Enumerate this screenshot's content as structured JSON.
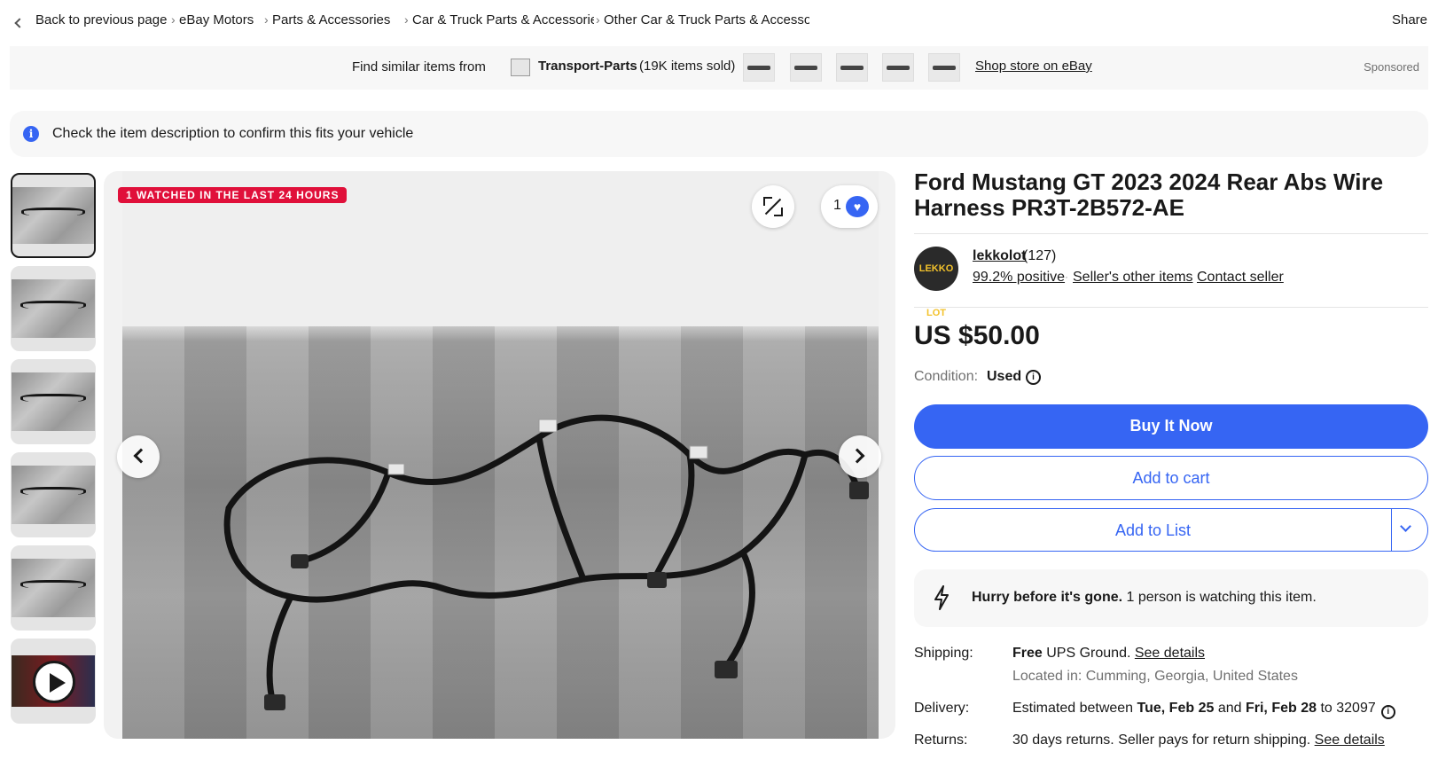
{
  "breadcrumb": {
    "back": "Back to previous page",
    "items": [
      "eBay Motors",
      "Parts & Accessories",
      "Car & Truck Parts & Accessories",
      "Other Car & Truck Parts & Accessories"
    ],
    "share": "Share"
  },
  "sponsor": {
    "find_text": "Find similar items from",
    "store_name": "Transport-Parts",
    "items_sold": "(19K items sold)",
    "shop_link": "Shop store on eBay",
    "sponsored": "Sponsored"
  },
  "notice": {
    "text": "Check the item description to confirm this fits your vehicle"
  },
  "gallery": {
    "watch_badge": "1 WATCHED IN THE LAST 24 HOURS",
    "watch_count": "1"
  },
  "item": {
    "title": "Ford Mustang GT 2023 2024 Rear Abs Wire Harness PR3T-2B572-AE",
    "price": "US $50.00",
    "condition_label": "Condition:",
    "condition_value": "Used"
  },
  "seller": {
    "name": "lekkolot",
    "feedback_count": "(127)",
    "positive": "99.2% positive",
    "other_items": "Seller's other items",
    "contact": "Contact seller",
    "avatar_text": "LEKKO LOT"
  },
  "buttons": {
    "buy_now": "Buy It Now",
    "add_cart": "Add to cart",
    "add_list": "Add to List"
  },
  "urgency": {
    "bold": "Hurry before it's gone.",
    "rest": " 1 person is watching this item."
  },
  "shipping": {
    "label": "Shipping:",
    "free": "Free",
    "method": "UPS Ground.",
    "see_details": "See details",
    "located_label": "Located in:",
    "location": "Cumming, Georgia, United States"
  },
  "delivery": {
    "label": "Delivery:",
    "prefix": "Estimated between",
    "start": "Tue, Feb 25",
    "and": "and",
    "end": "Fri, Feb 28",
    "to": "to 32097"
  },
  "returns": {
    "label": "Returns:",
    "days": "30 days returns.",
    "policy": "Seller pays for return shipping.",
    "see_details": "See details"
  },
  "colors": {
    "accent": "#3665f3",
    "badge": "#e0103a",
    "text": "#191919"
  }
}
